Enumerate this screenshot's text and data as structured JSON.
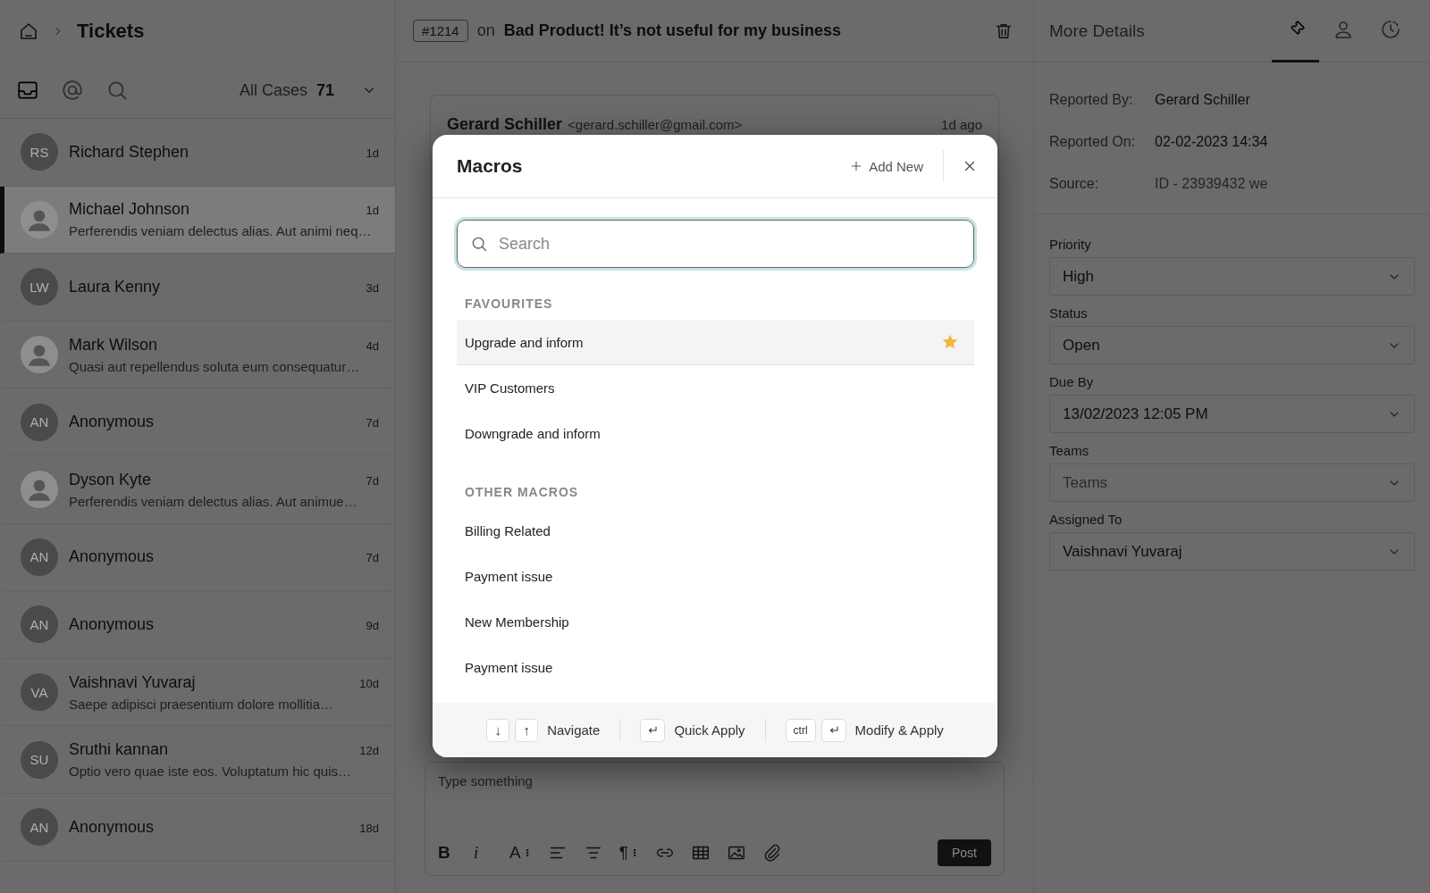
{
  "header": {
    "breadcrumb": "Tickets"
  },
  "list_toolbar": {
    "tabs": [
      {
        "kind": "inbox",
        "selected": true
      },
      {
        "kind": "mentions",
        "selected": false
      },
      {
        "kind": "search",
        "selected": false
      }
    ],
    "filter": "All Cases",
    "count": "71"
  },
  "tickets": [
    {
      "kind": "initials",
      "initials": "RS",
      "name": "Richard Stephen",
      "time": "1d",
      "selected": false
    },
    {
      "kind": "photo",
      "name": "Michael Johnson",
      "time": "1d",
      "preview": "Perferendis veniam delectus alias. Aut animi neq…",
      "selected": true
    },
    {
      "kind": "initials",
      "initials": "LW",
      "name": "Laura Kenny",
      "time": "3d",
      "selected": false
    },
    {
      "kind": "photo",
      "name": "Mark Wilson",
      "time": "4d",
      "preview": "Quasi aut repellendus soluta eum consequatur…",
      "selected": false
    },
    {
      "kind": "initials",
      "initials": "AN",
      "name": "Anonymous",
      "time": "7d",
      "selected": false
    },
    {
      "kind": "photo",
      "name": "Dyson Kyte",
      "time": "7d",
      "preview": "Perferendis veniam delectus alias. Aut animue…",
      "selected": false
    },
    {
      "kind": "initials",
      "initials": "AN",
      "name": "Anonymous",
      "time": "7d",
      "selected": false
    },
    {
      "kind": "initials",
      "initials": "AN",
      "name": "Anonymous",
      "time": "9d",
      "selected": false
    },
    {
      "kind": "initials",
      "initials": "VA",
      "name": "Vaishnavi Yuvaraj",
      "time": "10d",
      "preview": "Saepe adipisci praesentium dolore mollitia…",
      "selected": false
    },
    {
      "kind": "initials",
      "initials": "SU",
      "name": "Sruthi kannan",
      "time": "12d",
      "preview": "Optio vero quae iste eos. Voluptatum hic quis…",
      "selected": false
    },
    {
      "kind": "initials",
      "initials": "AN",
      "name": "Anonymous",
      "time": "18d",
      "selected": false
    }
  ],
  "ticket": {
    "number": "#1214",
    "connector": "on",
    "subject": "Bad Product! It’s not useful for my business"
  },
  "message": {
    "author": "Gerard Schiller",
    "email": "<gerard.schiller@gmail.com>",
    "time": "1d ago"
  },
  "composer": {
    "placeholder": "Type something",
    "tools": [
      {
        "kind": "bold",
        "text": "B"
      },
      {
        "kind": "italic",
        "text": "i"
      },
      {
        "kind": "text-size",
        "text": "A"
      },
      {
        "kind": "align-left"
      },
      {
        "kind": "align-center"
      },
      {
        "kind": "paragraph",
        "text": "¶"
      },
      {
        "kind": "link"
      },
      {
        "kind": "table"
      },
      {
        "kind": "image"
      },
      {
        "kind": "attach"
      }
    ],
    "post": "Post"
  },
  "details": {
    "title": "More Details",
    "tabs": [
      {
        "kind": "ticket",
        "selected": true
      },
      {
        "kind": "person",
        "selected": false
      },
      {
        "kind": "history",
        "selected": false
      }
    ],
    "info": [
      {
        "label": "Reported By:",
        "value": "Gerard Schiller",
        "muted": false
      },
      {
        "label": "Reported On:",
        "value": "02-02-2023 14:34",
        "muted": false
      },
      {
        "label": "Source:",
        "value": "ID - 23939432 we",
        "muted": true
      }
    ],
    "fields": [
      {
        "label": "Priority",
        "value": "High"
      },
      {
        "label": "Status",
        "value": "Open"
      },
      {
        "label": "Due By",
        "value": "13/02/2023 12:05 PM"
      },
      {
        "label": "Teams",
        "placeholder": "Teams"
      },
      {
        "label": "Assigned To",
        "value": "Vaishnavi Yuvaraj"
      }
    ]
  },
  "macros": {
    "title": "Macros",
    "add": "Add New",
    "search": {
      "placeholder": "Search"
    },
    "sections": [
      {
        "heading": "FAVOURITES",
        "items": [
          {
            "label": "Upgrade and inform",
            "selected": true,
            "favourite": true
          },
          {
            "label": "VIP Customers",
            "selected": false,
            "favourite": false
          },
          {
            "label": "Downgrade and inform",
            "selected": false,
            "favourite": false
          }
        ]
      },
      {
        "heading": "OTHER MACROS",
        "items": [
          {
            "label": "Billing Related",
            "selected": false,
            "favourite": false
          },
          {
            "label": "Payment issue",
            "selected": false,
            "favourite": false
          },
          {
            "label": "New Membership",
            "selected": false,
            "favourite": false
          },
          {
            "label": "Payment issue",
            "selected": false,
            "favourite": false
          }
        ]
      }
    ],
    "shortcuts": [
      {
        "keys": [
          {
            "kind": "text",
            "text": "↓"
          },
          {
            "kind": "text",
            "text": "↑"
          }
        ],
        "label": "Navigate"
      },
      {
        "keys": [
          {
            "kind": "enter"
          }
        ],
        "label": "Quick Apply"
      },
      {
        "keys": [
          {
            "kind": "text",
            "text": "ctrl"
          },
          {
            "kind": "enter"
          }
        ],
        "label": "Modify & Apply"
      }
    ]
  }
}
